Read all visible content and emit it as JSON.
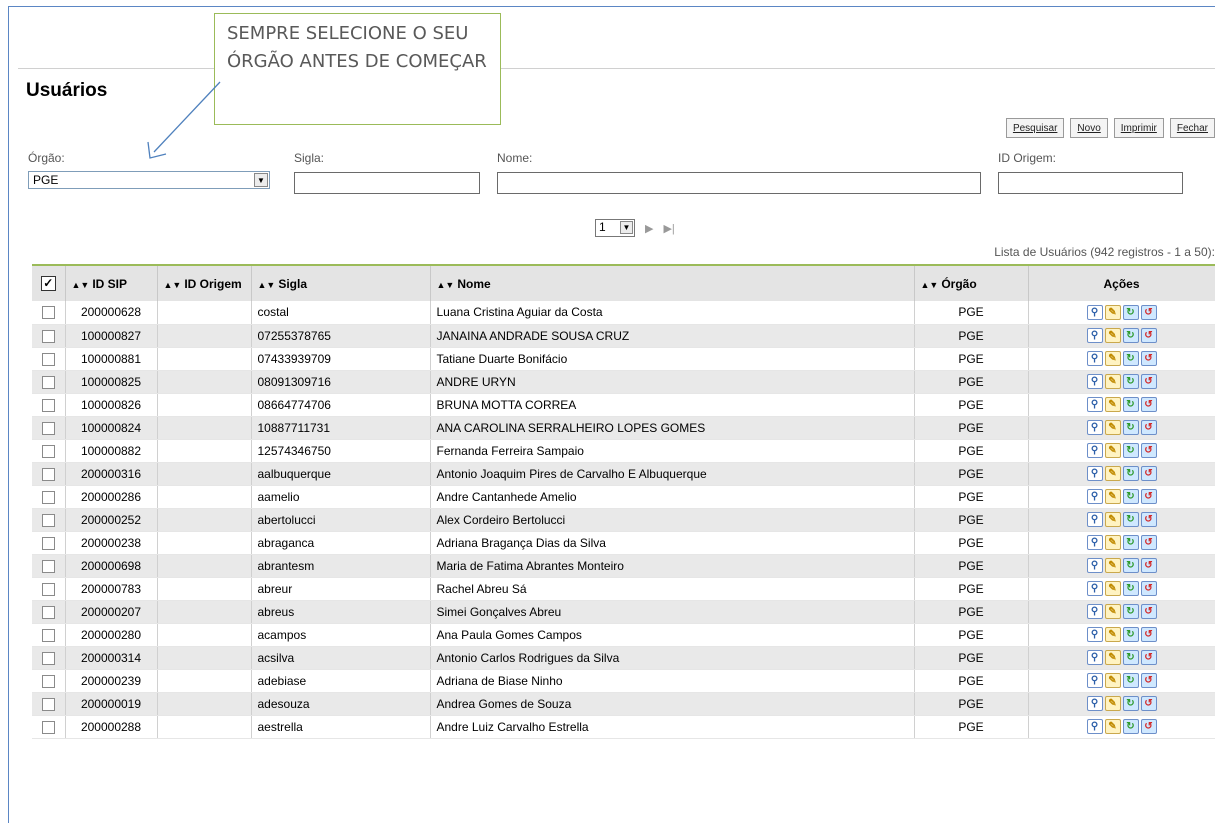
{
  "page": {
    "title": "Usuários"
  },
  "callout": {
    "text": "SEMPRE SELECIONE O SEU ÓRGÃO ANTES DE COMEÇAR"
  },
  "toolbar": {
    "search_label": "Pesquisar",
    "new_label": "Novo",
    "print_label": "Imprimir",
    "close_label": "Fechar"
  },
  "filters": {
    "orgao_label": "Órgão:",
    "orgao_value": "PGE",
    "sigla_label": "Sigla:",
    "nome_label": "Nome:",
    "origem_label": "ID Origem:"
  },
  "pager": {
    "page": "1"
  },
  "list": {
    "caption": "Lista de Usuários (942 registros - 1 a 50):"
  },
  "table": {
    "headers": [
      "ID SIP",
      "ID Origem",
      "Sigla",
      "Nome",
      "Órgão",
      "Ações"
    ],
    "rows": [
      [
        "200000628",
        "",
        "costal",
        "Luana Cristina Aguiar da Costa",
        "PGE"
      ],
      [
        "100000827",
        "",
        "07255378765",
        "JANAINA ANDRADE SOUSA CRUZ",
        "PGE"
      ],
      [
        "100000881",
        "",
        "07433939709",
        "Tatiane Duarte Bonifácio",
        "PGE"
      ],
      [
        "100000825",
        "",
        "08091309716",
        "ANDRE URYN",
        "PGE"
      ],
      [
        "100000826",
        "",
        "08664774706",
        "BRUNA MOTTA CORREA",
        "PGE"
      ],
      [
        "100000824",
        "",
        "10887711731",
        "ANA CAROLINA SERRALHEIRO LOPES GOMES",
        "PGE"
      ],
      [
        "100000882",
        "",
        "12574346750",
        "Fernanda Ferreira Sampaio",
        "PGE"
      ],
      [
        "200000316",
        "",
        "aalbuquerque",
        "Antonio Joaquim Pires de Carvalho E Albuquerque",
        "PGE"
      ],
      [
        "200000286",
        "",
        "aamelio",
        "Andre Cantanhede Amelio",
        "PGE"
      ],
      [
        "200000252",
        "",
        "abertolucci",
        "Alex Cordeiro Bertolucci",
        "PGE"
      ],
      [
        "200000238",
        "",
        "abraganca",
        "Adriana Bragança Dias da Silva",
        "PGE"
      ],
      [
        "200000698",
        "",
        "abrantesm",
        "Maria de Fatima Abrantes Monteiro",
        "PGE"
      ],
      [
        "200000783",
        "",
        "abreur",
        "Rachel Abreu Sá",
        "PGE"
      ],
      [
        "200000207",
        "",
        "abreus",
        "Simei Gonçalves Abreu",
        "PGE"
      ],
      [
        "200000280",
        "",
        "acampos",
        "Ana Paula Gomes Campos",
        "PGE"
      ],
      [
        "200000314",
        "",
        "acsilva",
        "Antonio Carlos Rodrigues da Silva",
        "PGE"
      ],
      [
        "200000239",
        "",
        "adebiase",
        "Adriana de Biase Ninho",
        "PGE"
      ],
      [
        "200000019",
        "",
        "adesouza",
        "Andrea Gomes de Souza",
        "PGE"
      ],
      [
        "200000288",
        "",
        "aestrella",
        "Andre Luiz Carvalho Estrella",
        "PGE"
      ]
    ]
  },
  "icons": {
    "view": "magnifier-icon",
    "edit": "pencil-icon",
    "green": "green-refresh-icon",
    "red": "red-refresh-icon"
  }
}
